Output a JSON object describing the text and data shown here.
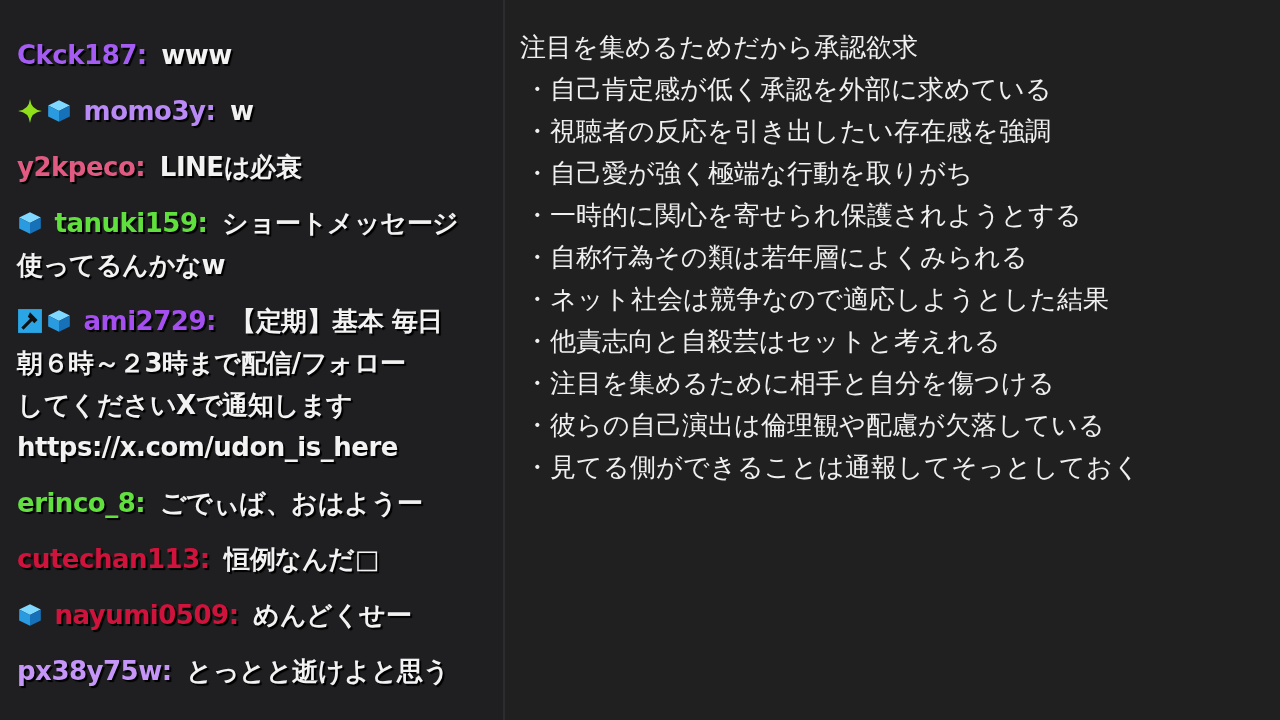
{
  "chat": {
    "messages": [
      {
        "user": "Ckck187:",
        "color": "#a45cf2",
        "lines": [
          "www"
        ]
      },
      {
        "badges": [
          {
            "kind": "sparkle"
          },
          {
            "kind": "cube"
          }
        ],
        "user": "momo3y:",
        "color": "#b98af5",
        "lines": [
          "w"
        ]
      },
      {
        "user": "y2kpeco:",
        "color": "#e05a82",
        "lines": [
          "LINEは必衰"
        ]
      },
      {
        "badges": [
          {
            "kind": "cube"
          }
        ],
        "user": "tanuki159:",
        "color": "#5fe03c",
        "lines": [
          "ショートメッセージ",
          "使ってるんかなw"
        ]
      },
      {
        "badges": [
          {
            "kind": "hammer"
          },
          {
            "kind": "cube"
          }
        ],
        "user": "ami2729:",
        "color": "#a64ff0",
        "lines": [
          "【定期】基本 毎日",
          "朝６時～２3時まで配信/フォロー",
          "してくださいXで通知します",
          "https://x.com/udon_is_here"
        ]
      },
      {
        "user": "erinco_8:",
        "color": "#62e040",
        "lines": [
          "ごでぃば、おはようー"
        ]
      },
      {
        "user": "cutechan113:",
        "color": "#d0133c",
        "lines": [
          "恒例なんだ□"
        ]
      },
      {
        "badges": [
          {
            "kind": "cube"
          }
        ],
        "user": "nayumi0509:",
        "color": "#d0133c",
        "lines": [
          "めんどくせー"
        ]
      },
      {
        "user": "px38y75w:",
        "color": "#c596f8",
        "lines": [
          "とっとと逝けよと思う"
        ]
      }
    ]
  },
  "notes": {
    "title": "注目を集めるためだから承認欲求",
    "items": [
      "・自己肯定感が低く承認を外部に求めている",
      "・視聴者の反応を引き出したい存在感を強調",
      "・自己愛が強く極端な行動を取りがち",
      "・一時的に関心を寄せられ保護されようとする",
      "・自称行為その類は若年層によくみられる",
      "・ネット社会は競争なので適応しようとした結果",
      "・他責志向と自殺芸はセットと考えれる",
      "・注目を集めるために相手と自分を傷つける",
      "・彼らの自己演出は倫理観や配慮が欠落している",
      "・見てる側ができることは通報してそっとしておく"
    ]
  }
}
